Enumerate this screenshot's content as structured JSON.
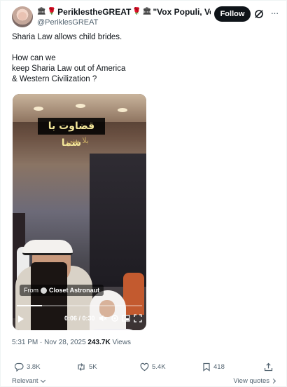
{
  "author": {
    "display_name_prefix_emojis": [
      "bank-icon",
      "rose-icon"
    ],
    "display_name": "PeriklestheGREAT",
    "display_name_suffix": "\"Vox Populi, Vo...",
    "handle": "@PeriklesGREAT",
    "verified": true
  },
  "header": {
    "follow_label": "Follow",
    "more_label": "···"
  },
  "tweet": {
    "line1": "Sharia Law allows child brides.",
    "line2": "How can we",
    "line3": "keep Sharia Law out of America",
    "line4": "& Western Civilization ?"
  },
  "video": {
    "overlay_title": "قضاوت با شما",
    "overlay_sub": "بلا بيني",
    "from_label": "From",
    "source_name": "Closet Astronaut",
    "current_time": "0:06",
    "duration": "0:30",
    "time_display": "0:06 / 0:30",
    "progress_fraction": 0.2,
    "controls": [
      "play-icon",
      "mute-icon",
      "settings-icon",
      "picture-in-picture-icon",
      "fullscreen-icon"
    ]
  },
  "meta": {
    "time": "5:31 PM",
    "separator": " · ",
    "date": "Nov 28, 2025",
    "views_count": "243.7K",
    "views_label": "Views"
  },
  "actions": {
    "replies": "3.8K",
    "reposts": "5K",
    "likes": "5.4K",
    "bookmarks": "418"
  },
  "footer": {
    "sort_label": "Relevant",
    "view_quotes_label": "View quotes"
  },
  "colors": {
    "text": "#0f1419",
    "secondary": "#536471",
    "verified": "#1d9bf0",
    "follow_bg": "#0f1419"
  }
}
